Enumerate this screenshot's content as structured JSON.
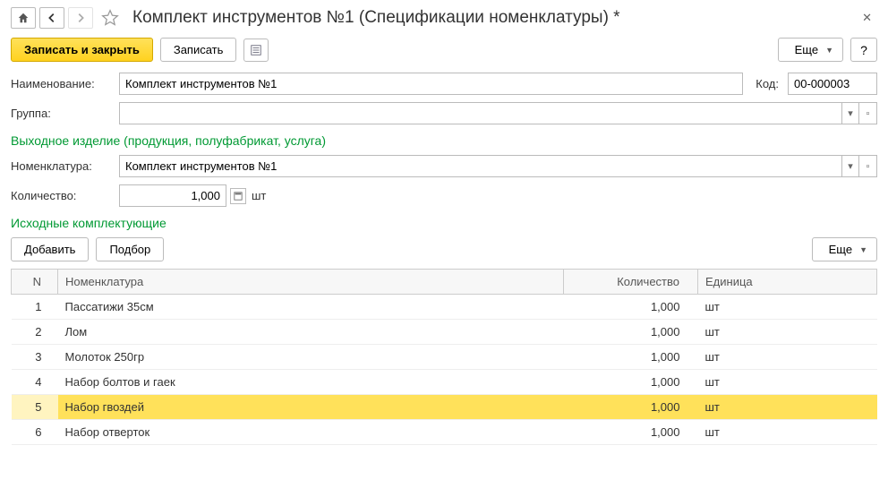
{
  "header": {
    "title": "Комплект инструментов №1 (Спецификации номенклатуры) *"
  },
  "toolbar": {
    "save_close": "Записать и закрыть",
    "save": "Записать",
    "more": "Еще",
    "help": "?"
  },
  "fields": {
    "name_label": "Наименование:",
    "name_value": "Комплект инструментов №1",
    "code_label": "Код:",
    "code_value": "00-000003",
    "group_label": "Группа:",
    "group_value": "",
    "nomenclature_label": "Номенклатура:",
    "nomenclature_value": "Комплект инструментов №1",
    "quantity_label": "Количество:",
    "quantity_value": "1,000",
    "quantity_unit": "шт"
  },
  "sections": {
    "output": "Выходное изделие (продукция, полуфабрикат, услуга)",
    "components": "Исходные комплектующие"
  },
  "table_toolbar": {
    "add": "Добавить",
    "pick": "Подбор",
    "more": "Еще"
  },
  "table": {
    "headers": {
      "n": "N",
      "nomenclature": "Номенклатура",
      "quantity": "Количество",
      "unit": "Единица"
    },
    "rows": [
      {
        "n": "1",
        "name": "Пассатижи 35см",
        "qty": "1,000",
        "unit": "шт",
        "selected": false
      },
      {
        "n": "2",
        "name": "Лом",
        "qty": "1,000",
        "unit": "шт",
        "selected": false
      },
      {
        "n": "3",
        "name": "Молоток 250гр",
        "qty": "1,000",
        "unit": "шт",
        "selected": false
      },
      {
        "n": "4",
        "name": "Набор болтов и гаек",
        "qty": "1,000",
        "unit": "шт",
        "selected": false
      },
      {
        "n": "5",
        "name": "Набор гвоздей",
        "qty": "1,000",
        "unit": "шт",
        "selected": true
      },
      {
        "n": "6",
        "name": "Набор отверток",
        "qty": "1,000",
        "unit": "шт",
        "selected": false
      }
    ]
  }
}
